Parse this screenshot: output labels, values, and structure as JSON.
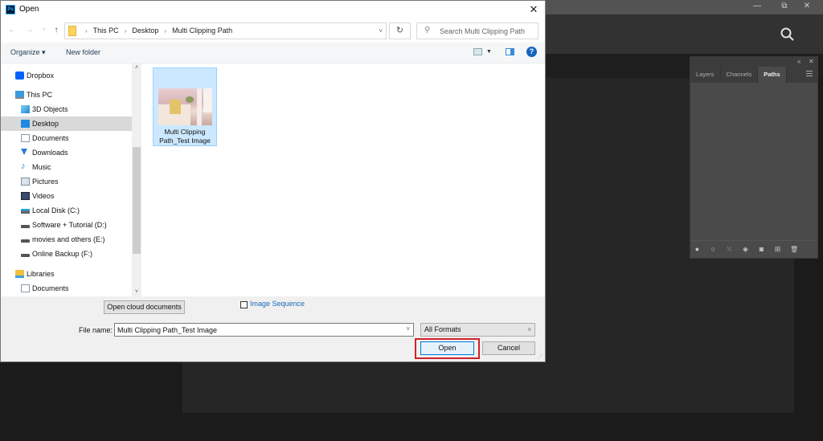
{
  "photoshop": {
    "window_controls": {
      "minimize": "—",
      "restore": "⧉",
      "close": "✕"
    },
    "search_icon": "search-icon",
    "panel": {
      "collapse_icon": "«",
      "close_icon": "✕",
      "tabs": [
        {
          "label": "Layers",
          "active": false
        },
        {
          "label": "Channels",
          "active": false
        },
        {
          "label": "Paths",
          "active": true
        }
      ],
      "footer_buttons": [
        {
          "name": "fill-path-icon",
          "glyph": "●"
        },
        {
          "name": "stroke-path-icon",
          "glyph": "○"
        },
        {
          "name": "load-selection-icon",
          "glyph": "⁙"
        },
        {
          "name": "make-work-path-icon",
          "glyph": "◈"
        },
        {
          "name": "add-mask-icon",
          "glyph": "◙"
        },
        {
          "name": "new-path-icon",
          "glyph": "⊞"
        },
        {
          "name": "delete-path-icon",
          "glyph": "🗑"
        }
      ]
    }
  },
  "dialog": {
    "title": "Open",
    "app_logo": "Ps",
    "close_glyph": "✕",
    "nav": {
      "back": "←",
      "forward": "→",
      "recent": "˅",
      "up": "↑"
    },
    "breadcrumb": [
      "This PC",
      "Desktop",
      "Multi Clipping Path"
    ],
    "breadcrumb_sep": "›",
    "address_dropdown": "˅",
    "refresh_glyph": "↻",
    "search_placeholder": "Search Multi Clipping Path",
    "search_glyph": "⚲",
    "toolbar": {
      "organize": "Organize ▾",
      "new_folder": "New folder",
      "view_dd": "▼",
      "help": "?"
    },
    "sidebar": [
      {
        "label": "Dropbox",
        "icon": "dropbox-icon",
        "level": 0,
        "selected": false
      },
      {
        "label": "This PC",
        "icon": "computer-icon",
        "level": 0,
        "selected": false
      },
      {
        "label": "3D Objects",
        "icon": "3d-objects-icon",
        "level": 1,
        "selected": false
      },
      {
        "label": "Desktop",
        "icon": "desktop-icon",
        "level": 1,
        "selected": true
      },
      {
        "label": "Documents",
        "icon": "documents-icon",
        "level": 1,
        "selected": false
      },
      {
        "label": "Downloads",
        "icon": "downloads-icon",
        "level": 1,
        "selected": false
      },
      {
        "label": "Music",
        "icon": "music-icon",
        "level": 1,
        "selected": false
      },
      {
        "label": "Pictures",
        "icon": "pictures-icon",
        "level": 1,
        "selected": false
      },
      {
        "label": "Videos",
        "icon": "videos-icon",
        "level": 1,
        "selected": false
      },
      {
        "label": "Local Disk (C:)",
        "icon": "system-drive-icon",
        "level": 1,
        "selected": false
      },
      {
        "label": "Software + Tutorial (D:)",
        "icon": "drive-icon",
        "level": 1,
        "selected": false
      },
      {
        "label": "movies and others (E:)",
        "icon": "drive-icon",
        "level": 1,
        "selected": false
      },
      {
        "label": "Online Backup (F:)",
        "icon": "drive-icon",
        "level": 1,
        "selected": false
      },
      {
        "label": "Libraries",
        "icon": "libraries-icon",
        "level": 0,
        "selected": false
      },
      {
        "label": "Documents",
        "icon": "documents-icon",
        "level": 1,
        "selected": false
      }
    ],
    "scroll": {
      "up": "˄",
      "down": "˅"
    },
    "files": [
      {
        "name": "Multi Clipping Path_Test Image",
        "selected": true
      }
    ],
    "footer": {
      "open_cloud": "Open cloud documents",
      "image_sequence_label": "Image Sequence",
      "image_sequence_checked": false,
      "file_name_label": "File name:",
      "file_name_value": "Multi Clipping Path_Test Image",
      "format_value": "All Formats",
      "dropdown_glyph": "˅",
      "open_label": "Open",
      "cancel_label": "Cancel",
      "grip": "⋰"
    },
    "highlight_color": "#d0202a"
  }
}
